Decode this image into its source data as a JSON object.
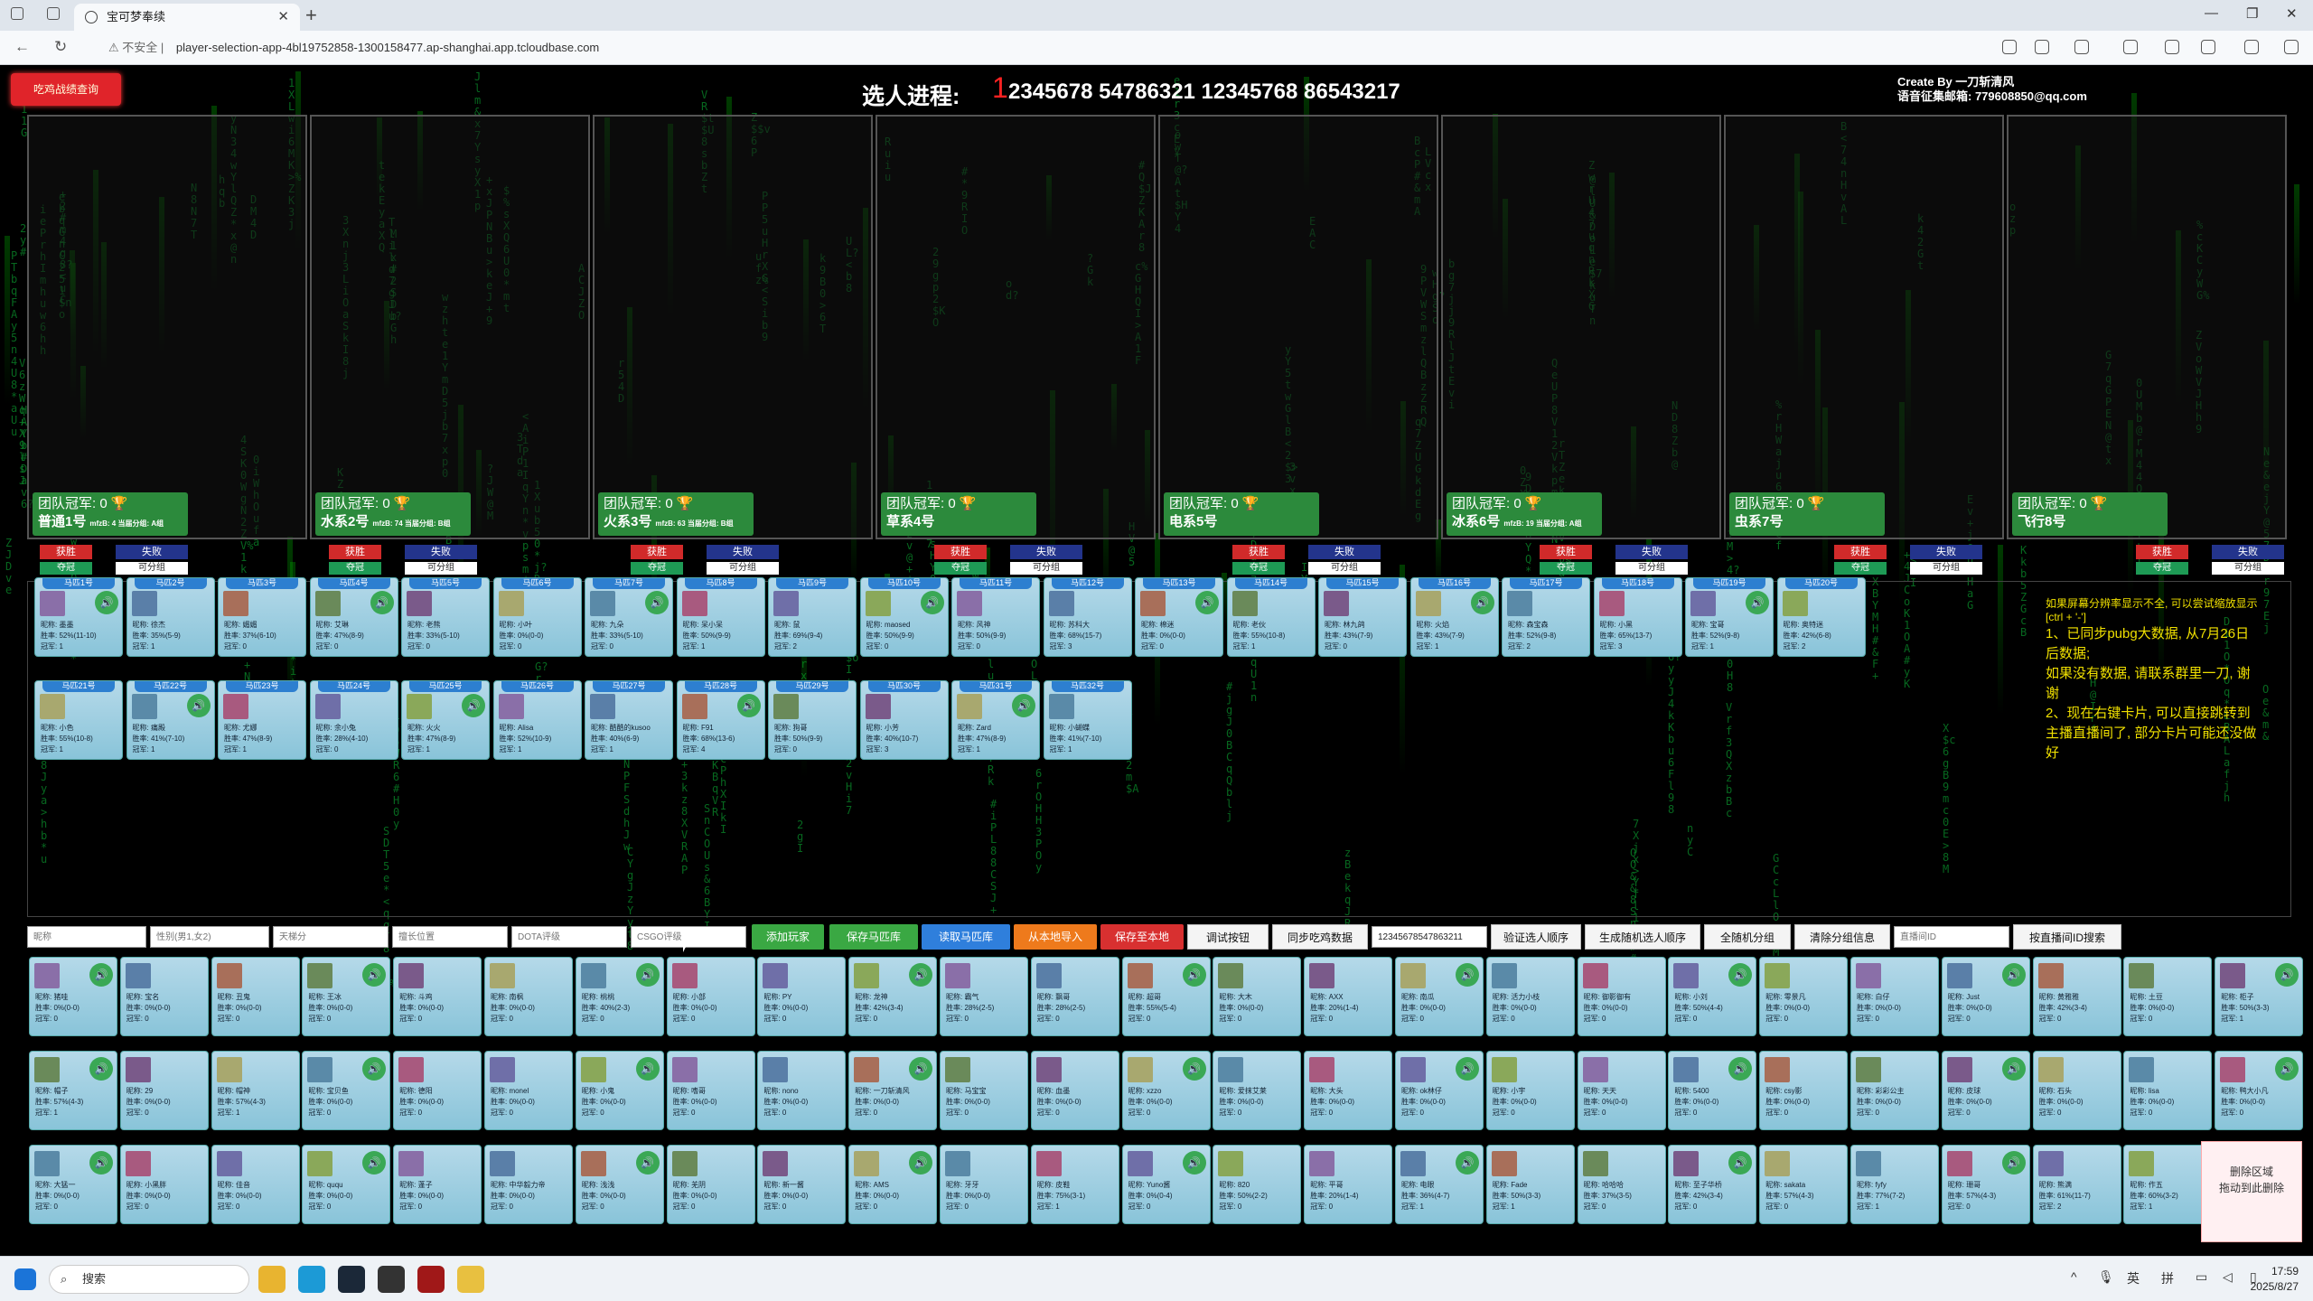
{
  "browser": {
    "tab_title": "宝可梦奉续",
    "address_warning": "不安全",
    "url": "player-selection-app-4bl19752858-1300158477.ap-shanghai.app.tcloudbase.com"
  },
  "header": {
    "query_button": "吃鸡战绩查询",
    "progress_label": "选人进程:",
    "progress_current": "1",
    "progress_text": "2345678 54786321 12345768 86543217",
    "credit_line1": "Create By 一刀斩清风",
    "credit_line2": "语音征集邮箱: 779608850@qq.com"
  },
  "teams": [
    {
      "champ": "团队冠军: 0 🏆",
      "name": "普通1号",
      "stats": "mfzB: 4 当届分组: A组"
    },
    {
      "champ": "团队冠军: 0 🏆",
      "name": "水系2号",
      "stats": "mfzB: 74 当届分组: B组"
    },
    {
      "champ": "团队冠军: 0 🏆",
      "name": "火系3号",
      "stats": "mfzB: 63 当届分组: B组"
    },
    {
      "champ": "团队冠军: 0 🏆",
      "name": "草系4号",
      "stats": ""
    },
    {
      "champ": "团队冠军: 0 🏆",
      "name": "电系5号",
      "stats": ""
    },
    {
      "champ": "团队冠军: 0 🏆",
      "name": "冰系6号",
      "stats": "mfzB: 19 当届分组: A组"
    },
    {
      "champ": "团队冠军: 0 🏆",
      "name": "虫系7号",
      "stats": ""
    },
    {
      "champ": "团队冠军: 0 🏆",
      "name": "飞行8号",
      "stats": ""
    }
  ],
  "team_buttons": {
    "win": "获胜",
    "lose": "失败",
    "champ": "夺冠",
    "group": "可分组"
  },
  "horse_row1": [
    {
      "tag": "马匹1号",
      "name": "昵称: 墨墨",
      "rate": "胜率: 52%(11-10)",
      "champ": "冠军: 1"
    },
    {
      "tag": "马匹2号",
      "name": "昵称: 徐杰",
      "rate": "胜率: 35%(5-9)",
      "champ": "冠军: 1"
    },
    {
      "tag": "马匹3号",
      "name": "昵称: 媚媚",
      "rate": "胜率: 37%(6-10)",
      "champ": "冠军: 0"
    },
    {
      "tag": "马匹4号",
      "name": "昵称: 艾琳",
      "rate": "胜率: 47%(8-9)",
      "champ": "冠军: 0"
    },
    {
      "tag": "马匹5号",
      "name": "昵称: 老熊",
      "rate": "胜率: 33%(5-10)",
      "champ": "冠军: 0"
    },
    {
      "tag": "马匹6号",
      "name": "昵称: 小叶",
      "rate": "胜率: 0%(0-0)",
      "champ": "冠军: 0"
    },
    {
      "tag": "马匹7号",
      "name": "昵称: 九朵",
      "rate": "胜率: 33%(5-10)",
      "champ": "冠军: 0"
    },
    {
      "tag": "马匹8号",
      "name": "昵称: 呆小呆",
      "rate": "胜率: 50%(9-9)",
      "champ": "冠军: 1"
    },
    {
      "tag": "马匹9号",
      "name": "昵称: 鼠",
      "rate": "胜率: 69%(9-4)",
      "champ": "冠军: 2"
    },
    {
      "tag": "马匹10号",
      "name": "昵称: maosed",
      "rate": "胜率: 50%(9-9)",
      "champ": "冠军: 0"
    },
    {
      "tag": "马匹11号",
      "name": "昵称: 风神",
      "rate": "胜率: 50%(9-9)",
      "champ": "冠军: 0"
    },
    {
      "tag": "马匹12号",
      "name": "昵称: 苏科大",
      "rate": "胜率: 68%(15-7)",
      "champ": "冠军: 3"
    },
    {
      "tag": "马匹13号",
      "name": "昵称: 棉迷",
      "rate": "胜率: 0%(0-0)",
      "champ": "冠军: 0"
    },
    {
      "tag": "马匹14号",
      "name": "昵称: 老伙",
      "rate": "胜率: 55%(10-8)",
      "champ": "冠军: 1"
    },
    {
      "tag": "马匹15号",
      "name": "昵称: 林九鸽",
      "rate": "胜率: 43%(7-9)",
      "champ": "冠军: 0"
    },
    {
      "tag": "马匹16号",
      "name": "昵称: 火焰",
      "rate": "胜率: 43%(7-9)",
      "champ": "冠军: 1"
    },
    {
      "tag": "马匹17号",
      "name": "昵称: 森宝森",
      "rate": "胜率: 52%(9-8)",
      "champ": "冠军: 2"
    },
    {
      "tag": "马匹18号",
      "name": "昵称: 小黑",
      "rate": "胜率: 65%(13-7)",
      "champ": "冠军: 3"
    },
    {
      "tag": "马匹19号",
      "name": "昵称: 宝哥",
      "rate": "胜率: 52%(9-8)",
      "champ": "冠军: 1"
    },
    {
      "tag": "马匹20号",
      "name": "昵称: 奥特迷",
      "rate": "胜率: 42%(6-8)",
      "champ": "冠军: 2"
    }
  ],
  "horse_row2": [
    {
      "tag": "马匹21号",
      "name": "昵称: 小色",
      "rate": "胜率: 55%(10-8)",
      "champ": "冠军: 1"
    },
    {
      "tag": "马匹22号",
      "name": "昵称: 痛殿",
      "rate": "胜率: 41%(7-10)",
      "champ": "冠军: 1"
    },
    {
      "tag": "马匹23号",
      "name": "昵称: 尤娜",
      "rate": "胜率: 47%(8-9)",
      "champ": "冠军: 1"
    },
    {
      "tag": "马匹24号",
      "name": "昵称: 余小兔",
      "rate": "胜率: 28%(4-10)",
      "champ": "冠军: 0"
    },
    {
      "tag": "马匹25号",
      "name": "昵称: 火火",
      "rate": "胜率: 47%(8-9)",
      "champ": "冠军: 1"
    },
    {
      "tag": "马匹26号",
      "name": "昵称: Alisa",
      "rate": "胜率: 52%(10-9)",
      "champ": "冠军: 1"
    },
    {
      "tag": "马匹27号",
      "name": "昵称: 酷酷的kusoo",
      "rate": "胜率: 40%(6-9)",
      "champ": "冠军: 1"
    },
    {
      "tag": "马匹28号",
      "name": "昵称: F91",
      "rate": "胜率: 68%(13-6)",
      "champ": "冠军: 4"
    },
    {
      "tag": "马匹29号",
      "name": "昵称: 狗哥",
      "rate": "胜率: 50%(9-9)",
      "champ": "冠军: 0"
    },
    {
      "tag": "马匹30号",
      "name": "昵称: 小芳",
      "rate": "胜率: 40%(10-7)",
      "champ": "冠军: 3"
    },
    {
      "tag": "马匹31号",
      "name": "昵称: Zard",
      "rate": "胜率: 47%(8-9)",
      "champ": "冠军: 1"
    },
    {
      "tag": "马匹32号",
      "name": "昵称: 小蝴蝶",
      "rate": "胜率: 41%(7-10)",
      "champ": "冠军: 1"
    }
  ],
  "notice": {
    "small": "如果屏幕分辨率显示不全, 可以尝试缩放显示[ctrl + '-']",
    "l1": "1、已同步pubg大数据, 从7月26日后数据;",
    "l2": "如果没有数据, 请联系群里一刀, 谢谢",
    "l3": "2、现在右键卡片, 可以直接跳转到主播直播间了, 部分卡片可能还没做好"
  },
  "toolbar": {
    "ph_nick": "昵称",
    "ph_gender": "性别(男1,女2)",
    "ph_talent": "天梯分",
    "ph_pos": "擅长位置",
    "ph_dota": "DOTA评级",
    "ph_csgo": "CSGO评级",
    "add_player": "添加玩家",
    "save_lib": "保存马匹库",
    "read_lib": "读取马匹库",
    "import_local": "从本地导入",
    "save_local": "保存至本地",
    "debug": "调试按钮",
    "sync": "同步吃鸡数据",
    "order_value": "12345678547863211",
    "verify": "验证选人顺序",
    "gen_random": "生成随机选人顺序",
    "random_group": "全随机分组",
    "clear_group": "清除分组信息",
    "ph_live": "直播间ID",
    "search_live": "按直播间ID搜索"
  },
  "pool_rows": [
    [
      {
        "name": "昵称: 猪哇",
        "rate": "胜率: 0%(0-0)",
        "champ": "冠军: 0"
      },
      {
        "name": "昵称: 宝名",
        "rate": "胜率: 0%(0-0)",
        "champ": "冠军: 0"
      },
      {
        "name": "昵称: 丑鬼",
        "rate": "胜率: 0%(0-0)",
        "champ": "冠军: 0"
      },
      {
        "name": "昵称: 王冰",
        "rate": "胜率: 0%(0-0)",
        "champ": "冠军: 0"
      },
      {
        "name": "昵称: 斗鸡",
        "rate": "胜率: 0%(0-0)",
        "champ": "冠军: 0"
      },
      {
        "name": "昵称: 南枫",
        "rate": "胜率: 0%(0-0)",
        "champ": "冠军: 0"
      },
      {
        "name": "昵称: 桃桃",
        "rate": "胜率: 40%(2-3)",
        "champ": "冠军: 0"
      },
      {
        "name": "昵称: 小部",
        "rate": "胜率: 0%(0-0)",
        "champ": "冠军: 0"
      },
      {
        "name": "昵称: PY",
        "rate": "胜率: 0%(0-0)",
        "champ": "冠军: 0"
      },
      {
        "name": "昵称: 龙神",
        "rate": "胜率: 42%(3-4)",
        "champ": "冠军: 0"
      },
      {
        "name": "昵称: 霸气",
        "rate": "胜率: 28%(2-5)",
        "champ": "冠军: 0"
      },
      {
        "name": "昵称: 飘哥",
        "rate": "胜率: 28%(2-5)",
        "champ": "冠军: 0"
      },
      {
        "name": "昵称: 超哥",
        "rate": "胜率: 55%(5-4)",
        "champ": "冠军: 0"
      },
      {
        "name": "昵称: 大木",
        "rate": "胜率: 0%(0-0)",
        "champ": "冠军: 0"
      },
      {
        "name": "昵称: AXX",
        "rate": "胜率: 20%(1-4)",
        "champ": "冠军: 0"
      },
      {
        "name": "昵称: 南瓜",
        "rate": "胜率: 0%(0-0)",
        "champ": "冠军: 0"
      },
      {
        "name": "昵称: 活力小枝",
        "rate": "胜率: 0%(0-0)",
        "champ": "冠军: 0"
      },
      {
        "name": "昵称: 御影御有",
        "rate": "胜率: 0%(0-0)",
        "champ": "冠军: 0"
      },
      {
        "name": "昵称: 小刘",
        "rate": "胜率: 50%(4-4)",
        "champ": "冠军: 0"
      },
      {
        "name": "昵称: 零景凡",
        "rate": "胜率: 0%(0-0)",
        "champ": "冠军: 0"
      },
      {
        "name": "昵称: 白仔",
        "rate": "胜率: 0%(0-0)",
        "champ": "冠军: 0"
      },
      {
        "name": "昵称: Just",
        "rate": "胜率: 0%(0-0)",
        "champ": "冠军: 0"
      },
      {
        "name": "昵称: 黄雅雅",
        "rate": "胜率: 42%(3-4)",
        "champ": "冠军: 0"
      },
      {
        "name": "昵称: 土豆",
        "rate": "胜率: 0%(0-0)",
        "champ": "冠军: 0"
      },
      {
        "name": "昵称: 柜子",
        "rate": "胜率: 50%(3-3)",
        "champ": "冠军: 1"
      }
    ],
    [
      {
        "name": "昵称: 帽子",
        "rate": "胜率: 57%(4-3)",
        "champ": "冠军: 1"
      },
      {
        "name": "昵称: 29",
        "rate": "胜率: 0%(0-0)",
        "champ": "冠军: 0"
      },
      {
        "name": "昵称: 帽神",
        "rate": "胜率: 57%(4-3)",
        "champ": "冠军: 1"
      },
      {
        "name": "昵称: 宝贝鱼",
        "rate": "胜率: 0%(0-0)",
        "champ": "冠军: 0"
      },
      {
        "name": "昵称: 德阳",
        "rate": "胜率: 0%(0-0)",
        "champ": "冠军: 0"
      },
      {
        "name": "昵称: monel",
        "rate": "胜率: 0%(0-0)",
        "champ": "冠军: 0"
      },
      {
        "name": "昵称: 小鬼",
        "rate": "胜率: 0%(0-0)",
        "champ": "冠军: 0"
      },
      {
        "name": "昵称: 嗜哥",
        "rate": "胜率: 0%(0-0)",
        "champ": "冠军: 0"
      },
      {
        "name": "昵称: nono",
        "rate": "胜率: 0%(0-0)",
        "champ": "冠军: 0"
      },
      {
        "name": "昵称: 一刀斩清风",
        "rate": "胜率: 0%(0-0)",
        "champ": "冠军: 0"
      },
      {
        "name": "昵称: 马宝宝",
        "rate": "胜率: 0%(0-0)",
        "champ": "冠军: 0"
      },
      {
        "name": "昵称: 血墨",
        "rate": "胜率: 0%(0-0)",
        "champ": "冠军: 0"
      },
      {
        "name": "昵称: xzzo",
        "rate": "胜率: 0%(0-0)",
        "champ": "冠军: 0"
      },
      {
        "name": "昵称: 爱抹艾莱",
        "rate": "胜率: 0%(0-0)",
        "champ": "冠军: 0"
      },
      {
        "name": "昵称: 大头",
        "rate": "胜率: 0%(0-0)",
        "champ": "冠军: 0"
      },
      {
        "name": "昵称: ok林仔",
        "rate": "胜率: 0%(0-0)",
        "champ": "冠军: 0"
      },
      {
        "name": "昵称: 小宇",
        "rate": "胜率: 0%(0-0)",
        "champ": "冠军: 0"
      },
      {
        "name": "昵称: 天天",
        "rate": "胜率: 0%(0-0)",
        "champ": "冠军: 0"
      },
      {
        "name": "昵称: 5400",
        "rate": "胜率: 0%(0-0)",
        "champ": "冠军: 0"
      },
      {
        "name": "昵称: csy影",
        "rate": "胜率: 0%(0-0)",
        "champ": "冠军: 0"
      },
      {
        "name": "昵称: 彩彩公主",
        "rate": "胜率: 0%(0-0)",
        "champ": "冠军: 0"
      },
      {
        "name": "昵称: 皮球",
        "rate": "胜率: 0%(0-0)",
        "champ": "冠军: 0"
      },
      {
        "name": "昵称: 石头",
        "rate": "胜率: 0%(0-0)",
        "champ": "冠军: 0"
      },
      {
        "name": "昵称: lisa",
        "rate": "胜率: 0%(0-0)",
        "champ": "冠军: 0"
      },
      {
        "name": "昵称: 鸭大小凡",
        "rate": "胜率: 0%(0-0)",
        "champ": "冠军: 0"
      }
    ],
    [
      {
        "name": "昵称: 大猛一",
        "rate": "胜率: 0%(0-0)",
        "champ": "冠军: 0"
      },
      {
        "name": "昵称: 小黑胖",
        "rate": "胜率: 0%(0-0)",
        "champ": "冠军: 0"
      },
      {
        "name": "昵称: 佳音",
        "rate": "胜率: 0%(0-0)",
        "champ": "冠军: 0"
      },
      {
        "name": "昵称: ququ",
        "rate": "胜率: 0%(0-0)",
        "champ": "冠军: 0"
      },
      {
        "name": "昵称: 蓬子",
        "rate": "胜率: 0%(0-0)",
        "champ": "冠军: 0"
      },
      {
        "name": "昵称: 中华毅力帝",
        "rate": "胜率: 0%(0-0)",
        "champ": "冠军: 0"
      },
      {
        "name": "昵称: 浅浅",
        "rate": "胜率: 0%(0-0)",
        "champ": "冠军: 0"
      },
      {
        "name": "昵称: 羌阴",
        "rate": "胜率: 0%(0-0)",
        "champ": "冠军: 0"
      },
      {
        "name": "昵称: 新一酱",
        "rate": "胜率: 0%(0-0)",
        "champ": "冠军: 0"
      },
      {
        "name": "昵称: AMS",
        "rate": "胜率: 0%(0-0)",
        "champ": "冠军: 0"
      },
      {
        "name": "昵称: 牙牙",
        "rate": "胜率: 0%(0-0)",
        "champ": "冠军: 0"
      },
      {
        "name": "昵称: 皮鞋",
        "rate": "胜率: 75%(3-1)",
        "champ": "冠军: 1"
      },
      {
        "name": "昵称: Yuno酱",
        "rate": "胜率: 0%(0-4)",
        "champ": "冠军: 0"
      },
      {
        "name": "昵称: 820",
        "rate": "胜率: 50%(2-2)",
        "champ": "冠军: 0"
      },
      {
        "name": "昵称: 平哥",
        "rate": "胜率: 20%(1-4)",
        "champ": "冠军: 0"
      },
      {
        "name": "昵称: 电眼",
        "rate": "胜率: 36%(4-7)",
        "champ": "冠军: 1"
      },
      {
        "name": "昵称: Fade",
        "rate": "胜率: 50%(3-3)",
        "champ": "冠军: 1"
      },
      {
        "name": "昵称: 哈哈哈",
        "rate": "胜率: 37%(3-5)",
        "champ": "冠军: 0"
      },
      {
        "name": "昵称: 至子华桥",
        "rate": "胜率: 42%(3-4)",
        "champ": "冠军: 0"
      },
      {
        "name": "昵称: sakata",
        "rate": "胜率: 57%(4-3)",
        "champ": "冠军: 0"
      },
      {
        "name": "昵称: fyfy",
        "rate": "胜率: 77%(7-2)",
        "champ": "冠军: 1"
      },
      {
        "name": "昵称: 珊哥",
        "rate": "胜率: 57%(4-3)",
        "champ": "冠军: 0"
      },
      {
        "name": "昵称: 熊满",
        "rate": "胜率: 61%(11-7)",
        "champ": "冠军: 2"
      },
      {
        "name": "昵称: 作五",
        "rate": "胜率: 60%(3-2)",
        "champ": "冠军: 1"
      }
    ]
  ],
  "delete_zone": {
    "l1": "删除区域",
    "l2": "拖动到此删除"
  },
  "taskbar": {
    "search": "搜索",
    "ime1": "英",
    "ime2": "拼",
    "time": "17:59",
    "date": "2025/8/27"
  },
  "colors": {
    "accent_red": "#d12a2a",
    "accent_blue": "#23348c",
    "accent_green": "#2c8a3c",
    "card_tag": "#2d7fd0",
    "rain_green": "#0a8a2a"
  }
}
